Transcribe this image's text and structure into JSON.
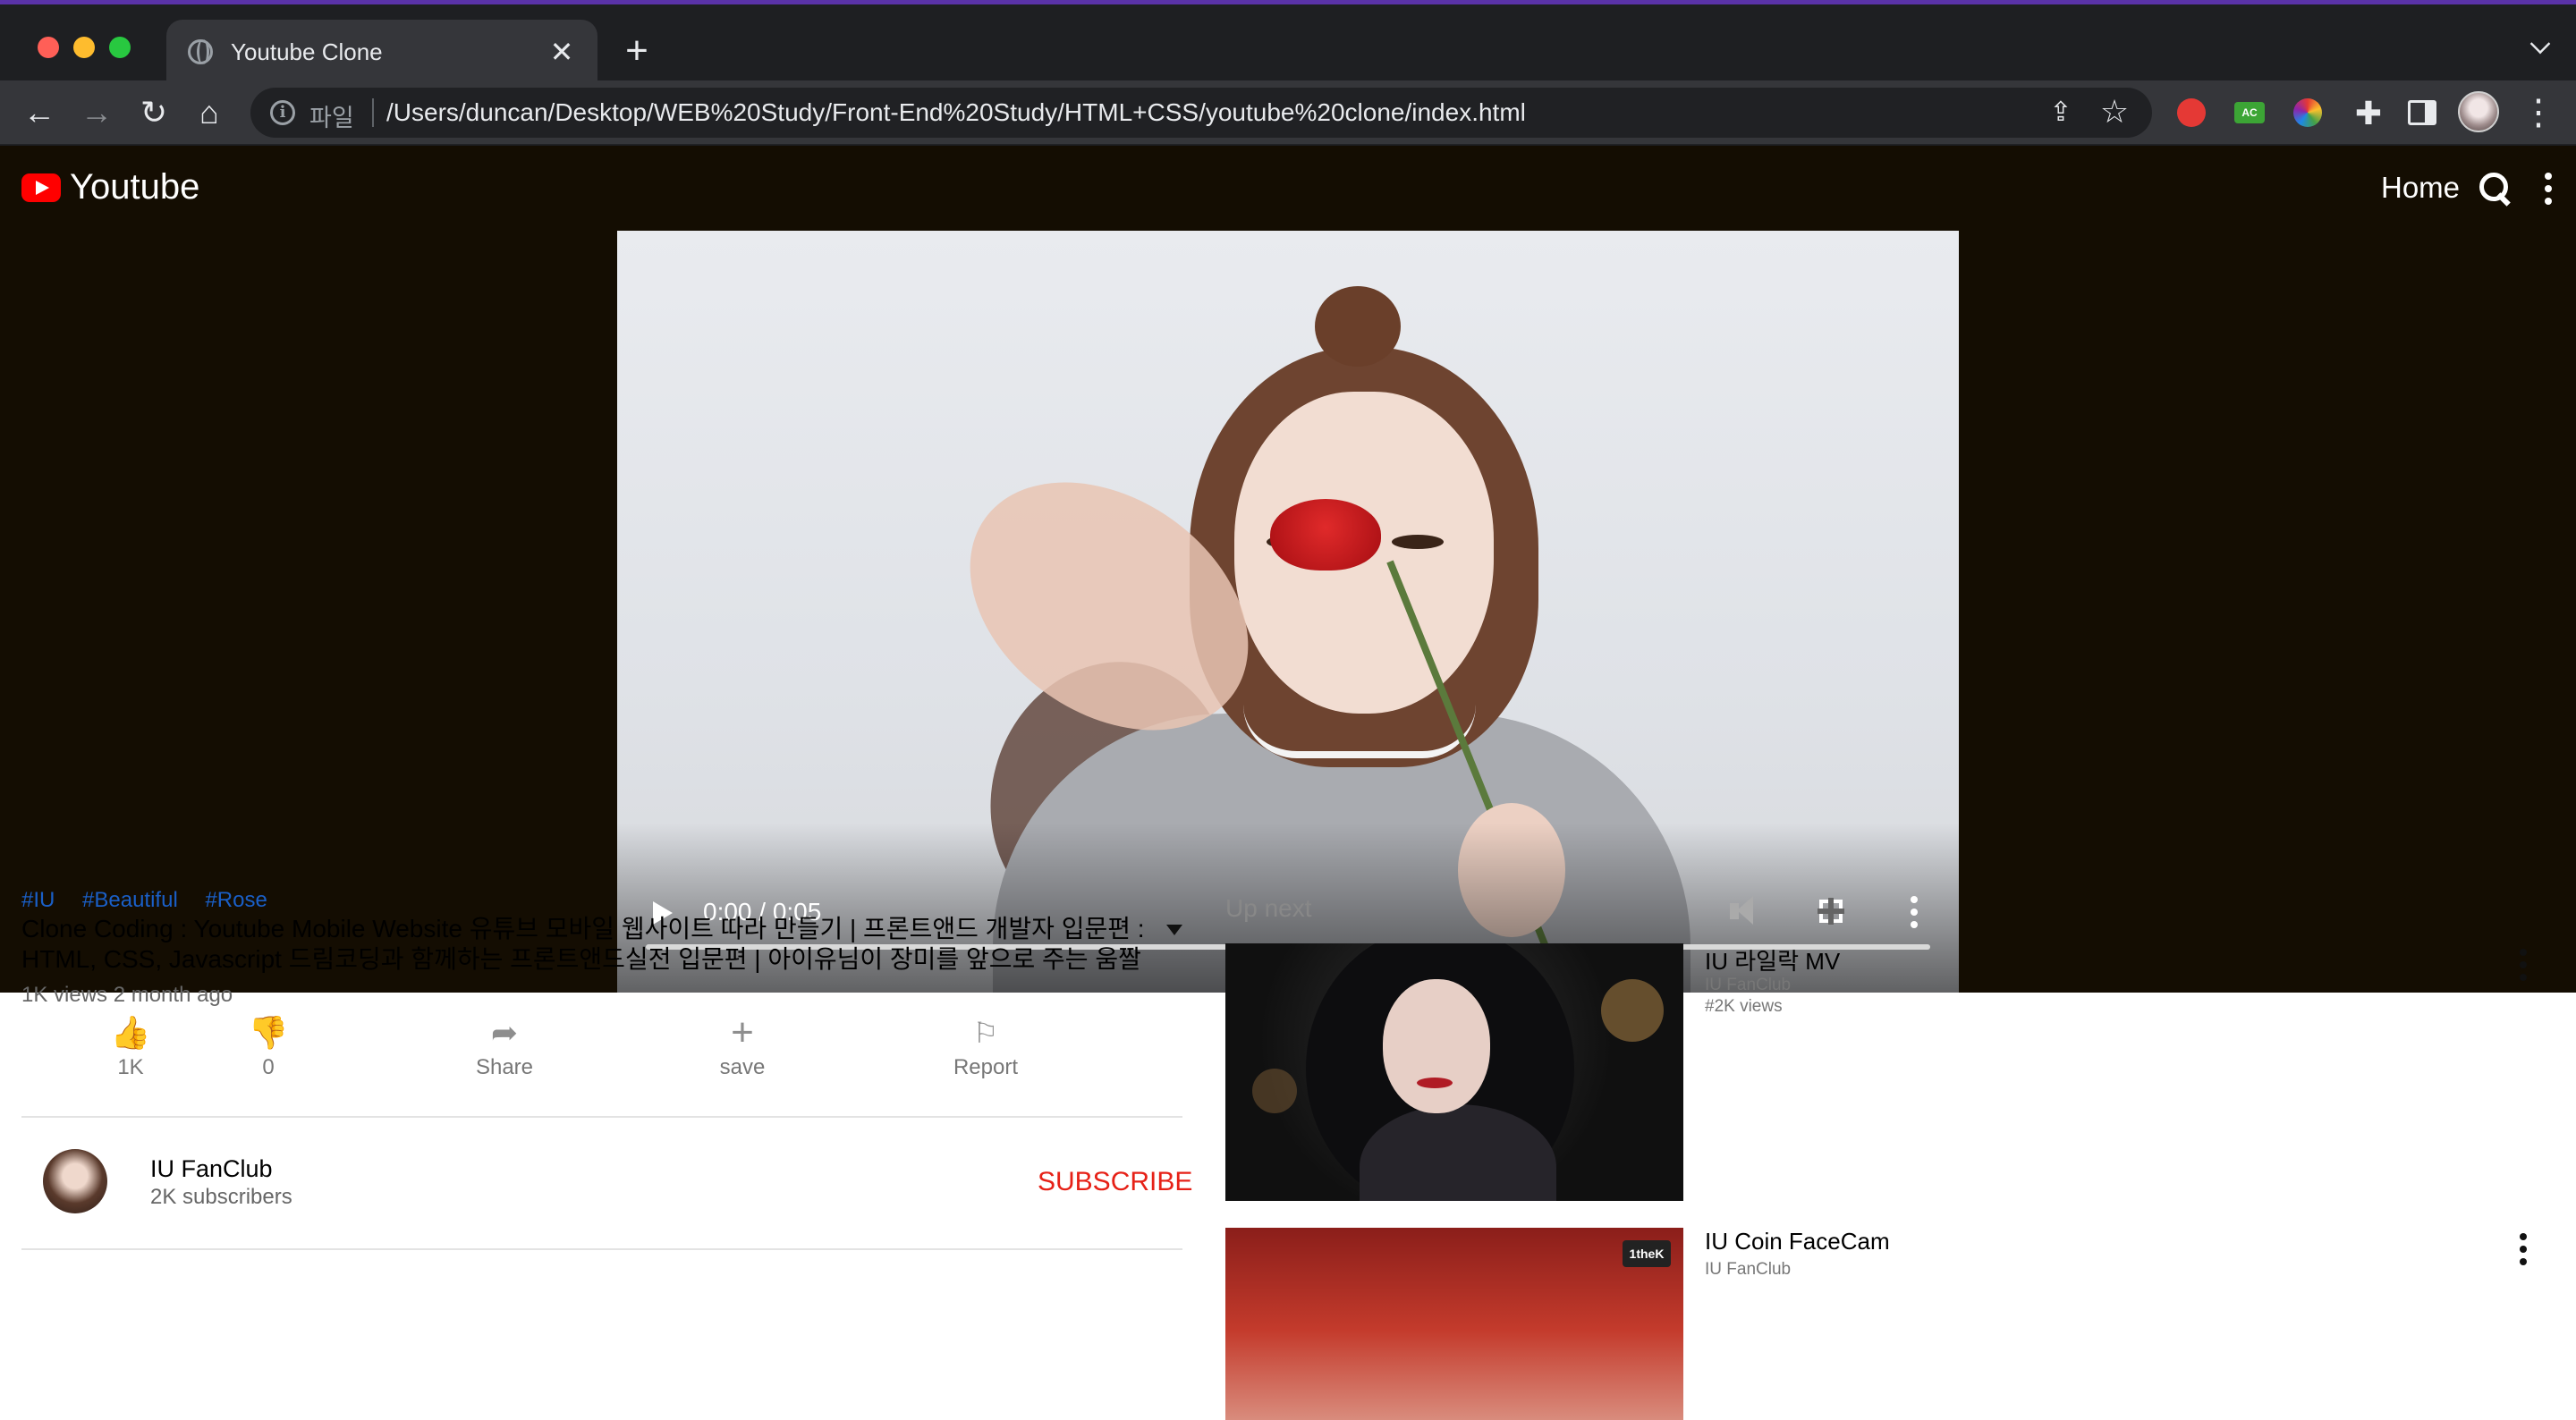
{
  "browser": {
    "tab_title": "Youtube Clone",
    "tab_close": "✕",
    "new_tab": "+",
    "file_label": "파일",
    "url": "/Users/duncan/Desktop/WEB%20Study/Front-End%20Study/HTML+CSS/youtube%20clone/index.html",
    "back_glyph": "←",
    "forward_glyph": "→",
    "reload_glyph": "↻",
    "home_glyph": "⌂",
    "star_glyph": "☆",
    "share_glyph": "⇪",
    "extension_glyph": "✚",
    "menu_glyph": "⋮",
    "ext_badge": "AC"
  },
  "header": {
    "brand": "Youtube",
    "home": "Home"
  },
  "player": {
    "time": "0:00 / 0:05",
    "progress": 0
  },
  "video": {
    "tags": [
      "#IU",
      "#Beautiful",
      "#Rose"
    ],
    "title": "Clone Coding : Youtube Mobile Website 유튜브 모바일 웹사이트 따라 만들기 | 프론트앤드 개발자 입문편 : HTML, CSS, Javascript 드림코딩과 함께하는 프론트앤드실전 입문편 | 아이유님이 장미를 앞으로 주는 움짤",
    "meta": "1K views 2 month ago"
  },
  "actions": {
    "like": {
      "glyph": "👍",
      "label": "1K"
    },
    "dislike": {
      "glyph": "👎",
      "label": "0"
    },
    "share": {
      "glyph": "➦",
      "label": "Share"
    },
    "save": {
      "glyph": "+",
      "label": "save"
    },
    "report": {
      "glyph": "⚐",
      "label": "Report"
    }
  },
  "channel": {
    "name": "IU FanClub",
    "subscribers": "2K subscribers",
    "subscribe": "SUBSCRIBE"
  },
  "up_next": {
    "heading": "Up next",
    "items": [
      {
        "title": "IU 라일락 MV",
        "channel": "IU FanClub",
        "views": "#2K views"
      },
      {
        "title": "IU Coin FaceCam",
        "channel": "IU FanClub",
        "views": ""
      }
    ],
    "thumb2_badge": "1theK"
  },
  "colors": {
    "header_bg": "#140d02",
    "accent_red": "#ff0000",
    "subscribe_red": "#e62117",
    "tag_blue": "#1a5fc7",
    "like_blue": "#1a62d2"
  }
}
